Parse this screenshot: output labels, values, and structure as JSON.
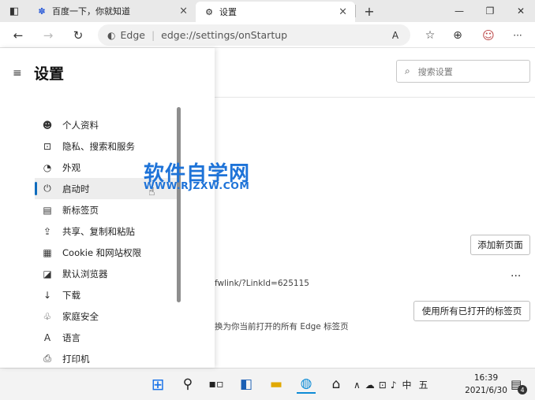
{
  "browser": {
    "tabs": [
      {
        "title": "百度一下，你就知道",
        "icon": "baidu-paw-icon",
        "close": "×"
      },
      {
        "title": "设置",
        "icon": "gear-icon",
        "close": "×"
      }
    ],
    "new_tab": "+",
    "window_buttons": {
      "minimize": "—",
      "restore": "❐",
      "close": "✕"
    },
    "nav": {
      "back": "←",
      "forward": "→",
      "refresh": "↻"
    },
    "address": {
      "brand": "Edge",
      "separator": "|",
      "url": "edge://settings/onStartup"
    },
    "toolbar": {
      "read_aloud": "A",
      "favorites": "☆",
      "collections": "⊕",
      "profile": "☺",
      "more": "···"
    }
  },
  "settings": {
    "menu_icon": "≡",
    "title": "设置",
    "search_placeholder": "搜索设置",
    "nav_items": [
      {
        "label": "个人资料",
        "icon": "profile-icon",
        "glyph": "☻"
      },
      {
        "label": "隐私、搜索和服务",
        "icon": "lock-icon",
        "glyph": "🔒"
      },
      {
        "label": "外观",
        "icon": "palette-icon",
        "glyph": "◔"
      },
      {
        "label": "启动时",
        "icon": "power-icon",
        "glyph": "⏻",
        "active": true
      },
      {
        "label": "新标签页",
        "icon": "new-tab-icon",
        "glyph": "▤"
      },
      {
        "label": "共享、复制和粘贴",
        "icon": "share-icon",
        "glyph": "⇪"
      },
      {
        "label": "Cookie 和网站权限",
        "icon": "site-permissions-icon",
        "glyph": "▦"
      },
      {
        "label": "默认浏览器",
        "icon": "default-browser-icon",
        "glyph": "◪"
      },
      {
        "label": "下载",
        "icon": "download-icon",
        "glyph": "↓"
      },
      {
        "label": "家庭安全",
        "icon": "family-icon",
        "glyph": "♧"
      },
      {
        "label": "语言",
        "icon": "language-icon",
        "glyph": "A"
      },
      {
        "label": "打印机",
        "icon": "printer-icon",
        "glyph": "⎙"
      }
    ],
    "add_new_page_button": "添加新页面",
    "link_fragment": "fwlink/?LinkId=625115",
    "more_dots": "···",
    "use_open_tabs_button": "使用所有已打开的标签页",
    "replace_text": "换为你当前打开的所有 Edge 标签页"
  },
  "watermark": {
    "line1": "软件自学网",
    "line2": "WWW.RJZXW.COM"
  },
  "taskbar": {
    "icons": [
      "windows-start-icon",
      "search-icon",
      "task-view-icon",
      "widgets-icon",
      "file-explorer-icon",
      "edge-icon",
      "store-icon"
    ],
    "tray": {
      "chevron": "∧",
      "ime": "中",
      "ime2": "五"
    },
    "time": "16:39",
    "date": "2021/6/30",
    "notification_count": "4"
  },
  "colors": {
    "accent": "#0f6cbd",
    "watermark": "#1e73d8"
  }
}
